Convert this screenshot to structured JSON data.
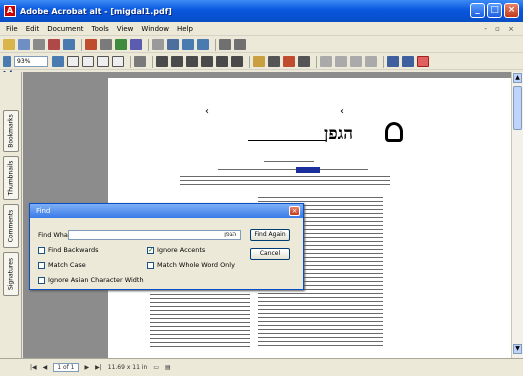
{
  "window": {
    "title": "Adobe Acrobat alt - [migdal1.pdf]"
  },
  "menu": {
    "items": [
      "File",
      "Edit",
      "Document",
      "Tools",
      "View",
      "Window",
      "Help"
    ],
    "doc_controls": "- ▫ ×"
  },
  "toolbar": {
    "zoom": "93%"
  },
  "nav_tabs": [
    "Bookmarks",
    "Thumbnails",
    "Comments",
    "Signatures"
  ],
  "document": {
    "logo_text": "הגפן"
  },
  "find_dialog": {
    "title": "Find",
    "find_what_label": "Find What:",
    "find_what_value": "הגפן",
    "find_again_label": "Find Again",
    "cancel_label": "Cancel",
    "options": [
      {
        "label": "Find Backwards",
        "checked": false
      },
      {
        "label": "Ignore Accents",
        "checked": true
      },
      {
        "label": "Match Case",
        "checked": false
      },
      {
        "label": "Match Whole Word Only",
        "checked": false
      },
      {
        "label": "Ignore Asian Character Width",
        "checked": false
      }
    ]
  },
  "status": {
    "page_indicator": "1 of 1",
    "page_size": "11.69 x 11 in"
  }
}
